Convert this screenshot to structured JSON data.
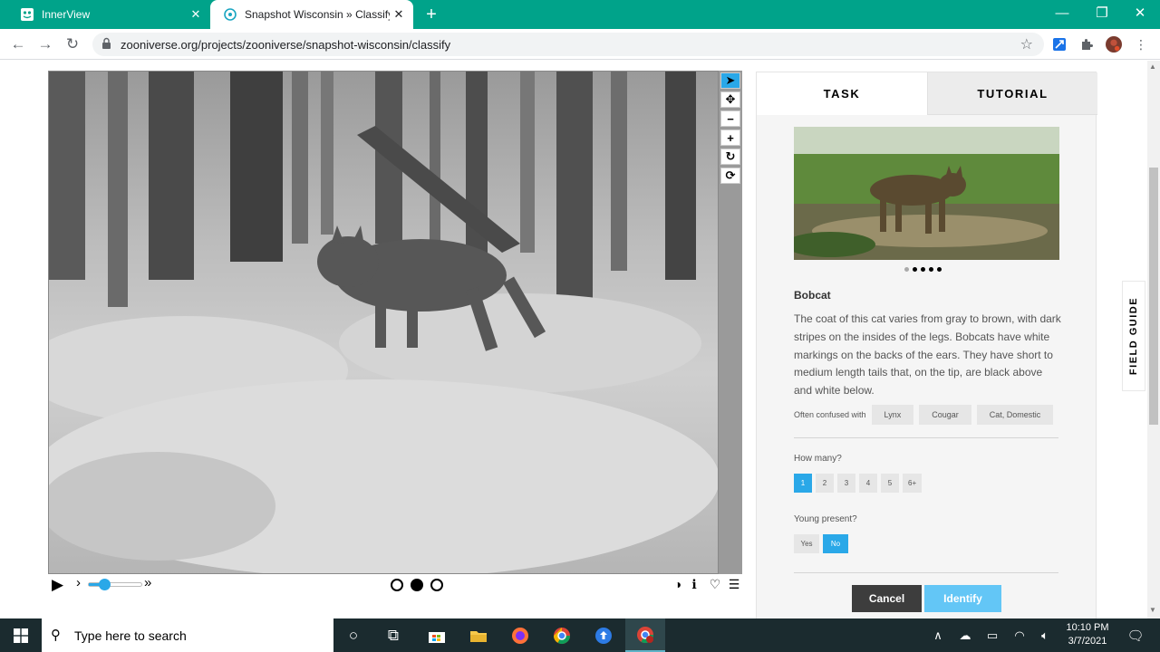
{
  "browser": {
    "tabs": [
      {
        "title": "InnerView",
        "active": false
      },
      {
        "title": "Snapshot Wisconsin » Classify —",
        "active": true
      }
    ],
    "url": "zooniverse.org/projects/zooniverse/snapshot-wisconsin/classify"
  },
  "viewer": {
    "tools": [
      "pointer-icon",
      "move-icon",
      "zoom-out-icon",
      "zoom-in-icon",
      "rotate-icon",
      "reset-icon"
    ],
    "playback": {
      "speed": 0.3,
      "frame_count": 3,
      "current_frame": 2
    }
  },
  "panel": {
    "tabs": {
      "task": "TASK",
      "tutorial": "TUTORIAL"
    },
    "gallery": {
      "count": 5,
      "current": 1
    },
    "animal_name": "Bobcat",
    "animal_description": "The coat of this cat varies from gray to brown, with dark stripes on the insides of the legs. Bobcats have white markings on the backs of the ears. They have short to medium length tails that, on the tip, are black above and white below.",
    "confused_label": "Often confused with",
    "confused_with": [
      "Lynx",
      "Cougar",
      "Cat, Domestic"
    ],
    "how_many": {
      "label": "How many?",
      "options": [
        "1",
        "2",
        "3",
        "4",
        "5",
        "6+"
      ],
      "selected": "1"
    },
    "young": {
      "label": "Young present?",
      "options": [
        "Yes",
        "No"
      ],
      "selected": "No"
    },
    "cancel_label": "Cancel",
    "identify_label": "Identify"
  },
  "field_guide": "FIELD GUIDE",
  "taskbar": {
    "search_placeholder": "Type here to search",
    "time": "10:10 PM",
    "date": "3/7/2021"
  },
  "colors": {
    "accent": "#2aa8e8",
    "tabbar": "#00a38a",
    "identify": "#63c6f6",
    "cancel": "#3d3d3d"
  }
}
